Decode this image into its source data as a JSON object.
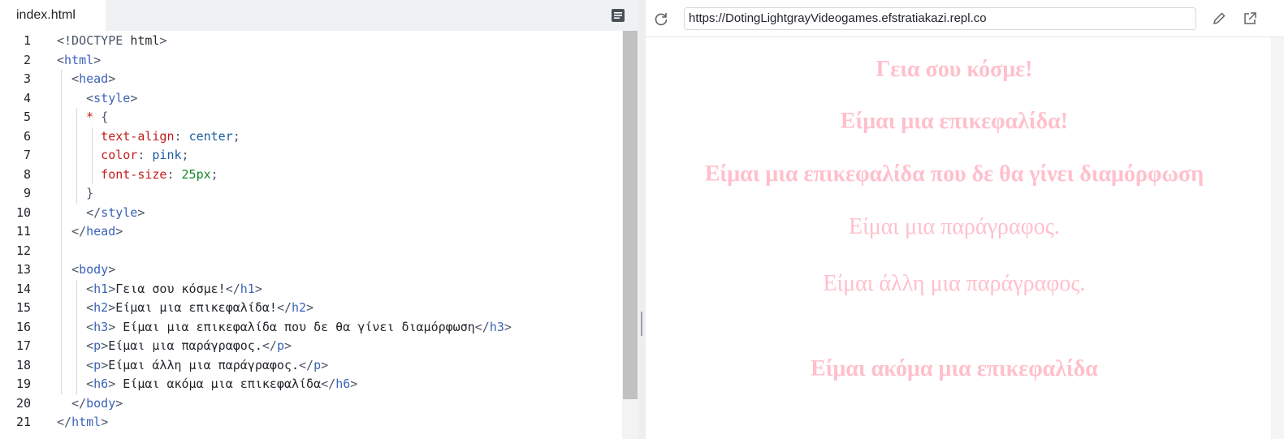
{
  "editor": {
    "tab_label": "index.html",
    "lines": [
      {
        "n": "1",
        "parts": [
          [
            "punct",
            "<!DOCTYPE "
          ],
          [
            "kw",
            "html"
          ],
          [
            "punct",
            ">"
          ]
        ]
      },
      {
        "n": "2",
        "parts": [
          [
            "punct",
            "<"
          ],
          [
            "tag",
            "html"
          ],
          [
            "punct",
            ">"
          ]
        ]
      },
      {
        "n": "3",
        "parts": [
          [
            "punct",
            "  <"
          ],
          [
            "tag",
            "head"
          ],
          [
            "punct",
            ">"
          ]
        ]
      },
      {
        "n": "4",
        "parts": [
          [
            "punct",
            "    <"
          ],
          [
            "tag",
            "style"
          ],
          [
            "punct",
            ">"
          ]
        ]
      },
      {
        "n": "5",
        "parts": [
          [
            "prop",
            "    * "
          ],
          [
            "punct",
            "{"
          ]
        ]
      },
      {
        "n": "6",
        "parts": [
          [
            "prop",
            "      text-align"
          ],
          [
            "punct",
            ": "
          ],
          [
            "val",
            "center"
          ],
          [
            "punct",
            ";"
          ]
        ]
      },
      {
        "n": "7",
        "parts": [
          [
            "prop",
            "      color"
          ],
          [
            "punct",
            ": "
          ],
          [
            "val",
            "pink"
          ],
          [
            "punct",
            ";"
          ]
        ]
      },
      {
        "n": "8",
        "parts": [
          [
            "prop",
            "      font-size"
          ],
          [
            "punct",
            ": "
          ],
          [
            "num",
            "25px"
          ],
          [
            "punct",
            ";"
          ]
        ]
      },
      {
        "n": "9",
        "parts": [
          [
            "punct",
            "    }"
          ]
        ]
      },
      {
        "n": "10",
        "parts": [
          [
            "punct",
            "    </"
          ],
          [
            "tag",
            "style"
          ],
          [
            "punct",
            ">"
          ]
        ]
      },
      {
        "n": "11",
        "parts": [
          [
            "punct",
            "  </"
          ],
          [
            "tag",
            "head"
          ],
          [
            "punct",
            ">"
          ]
        ]
      },
      {
        "n": "12",
        "parts": []
      },
      {
        "n": "13",
        "parts": [
          [
            "punct",
            "  <"
          ],
          [
            "tag",
            "body"
          ],
          [
            "punct",
            ">"
          ]
        ]
      },
      {
        "n": "14",
        "parts": [
          [
            "punct",
            "    <"
          ],
          [
            "tag",
            "h1"
          ],
          [
            "punct",
            ">"
          ],
          [
            "text",
            "Γεια σου κόσμε!"
          ],
          [
            "punct",
            "</"
          ],
          [
            "tag",
            "h1"
          ],
          [
            "punct",
            ">"
          ]
        ]
      },
      {
        "n": "15",
        "parts": [
          [
            "punct",
            "    <"
          ],
          [
            "tag",
            "h2"
          ],
          [
            "punct",
            ">"
          ],
          [
            "text",
            "Είμαι μια επικεφαλίδα!"
          ],
          [
            "punct",
            "</"
          ],
          [
            "tag",
            "h2"
          ],
          [
            "punct",
            ">"
          ]
        ]
      },
      {
        "n": "16",
        "parts": [
          [
            "punct",
            "    <"
          ],
          [
            "tag",
            "h3"
          ],
          [
            "punct",
            "> "
          ],
          [
            "text",
            "Είμαι μια επικεφαλίδα που δε θα γίνει διαμόρφωση"
          ],
          [
            "punct",
            "</"
          ],
          [
            "tag",
            "h3"
          ],
          [
            "punct",
            ">"
          ]
        ]
      },
      {
        "n": "17",
        "parts": [
          [
            "punct",
            "    <"
          ],
          [
            "tag",
            "p"
          ],
          [
            "punct",
            ">"
          ],
          [
            "text",
            "Είμαι μια παράγραφος."
          ],
          [
            "punct",
            "</"
          ],
          [
            "tag",
            "p"
          ],
          [
            "punct",
            ">"
          ]
        ]
      },
      {
        "n": "18",
        "parts": [
          [
            "punct",
            "    <"
          ],
          [
            "tag",
            "p"
          ],
          [
            "punct",
            ">"
          ],
          [
            "text",
            "Είμαι άλλη μια παράγραφος."
          ],
          [
            "punct",
            "</"
          ],
          [
            "tag",
            "p"
          ],
          [
            "punct",
            ">"
          ]
        ]
      },
      {
        "n": "19",
        "parts": [
          [
            "punct",
            "    <"
          ],
          [
            "tag",
            "h6"
          ],
          [
            "punct",
            "> "
          ],
          [
            "text",
            "Είμαι ακόμα μια επικεφαλίδα"
          ],
          [
            "punct",
            "</"
          ],
          [
            "tag",
            "h6"
          ],
          [
            "punct",
            ">"
          ]
        ]
      },
      {
        "n": "20",
        "parts": [
          [
            "punct",
            "  </"
          ],
          [
            "tag",
            "body"
          ],
          [
            "punct",
            ">"
          ]
        ]
      },
      {
        "n": "21",
        "parts": [
          [
            "punct",
            "</"
          ],
          [
            "tag",
            "html"
          ],
          [
            "punct",
            ">"
          ]
        ]
      }
    ]
  },
  "preview": {
    "url": "https://DotingLightgrayVideogames.efstratiakazi.repl.co",
    "h1": "Γεια σου κόσμε!",
    "h2": "Είμαι μια επικεφαλίδα!",
    "h3": "Είμαι μια επικεφαλίδα που δε θα γίνει διαμόρφωση",
    "p1": "Είμαι μια παράγραφος.",
    "p2": "Είμαι άλλη μια παράγραφος.",
    "h6": "Είμαι ακόμα μια επικεφαλίδα",
    "text_color": "#ffc0cb"
  },
  "icons": {
    "tab_menu": "file-menu-icon",
    "reload": "reload-icon",
    "edit": "pencil-icon",
    "open": "open-new-tab-icon"
  }
}
